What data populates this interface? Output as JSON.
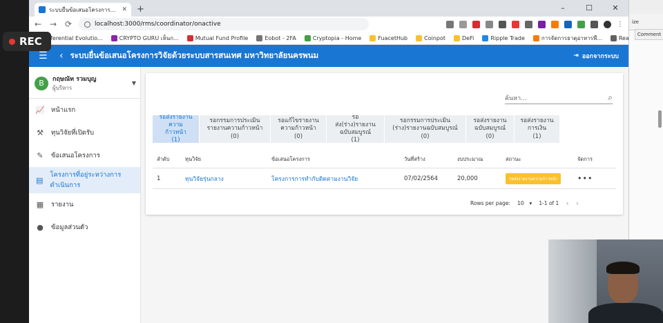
{
  "overlay": {
    "rec_label": "REC"
  },
  "browser": {
    "tab_title": "ระบบยื่นข้อเสนอโครงการวิจัยด้วยระบบสารสนเทศ",
    "url": "localhost:3000/rms/coordinator/onactive",
    "bookmarks": [
      {
        "label": "Differential Evolutio...",
        "color": "#3949ab"
      },
      {
        "label": "CRYPTO GURU เห็นก...",
        "color": "#8e24aa"
      },
      {
        "label": "Mutual Fund Profile",
        "color": "#d32f2f"
      },
      {
        "label": "Eobot - 2FA",
        "color": "#757575"
      },
      {
        "label": "Cryptopia - Home",
        "color": "#43a047"
      },
      {
        "label": "FuacetHub",
        "color": "#fbc02d"
      },
      {
        "label": "Coinpot",
        "color": "#fbc02d"
      },
      {
        "label": "DeFi",
        "color": "#fbc02d"
      },
      {
        "label": "Ripple Trade",
        "color": "#1e88e5"
      },
      {
        "label": "การจัดการธาตุอาหารพื...",
        "color": "#f57c00"
      },
      {
        "label": "Reading list",
        "color": "#616161"
      }
    ]
  },
  "app": {
    "title": "ระบบยื่นข้อเสนอโครงการวิจัยด้วยระบบสารสนเทศ มหาวิทยาลัยนครพนม",
    "logout_label": "ออกจากระบบ",
    "user": {
      "initial": "B",
      "name": "กฤษณัท รวมบุญ",
      "role": "ผู้บริหาร"
    },
    "menu": [
      {
        "label": "หน้าแรก",
        "icon": "chart-icon"
      },
      {
        "label": "ทุนวิจัยที่เปิดรับ",
        "icon": "hammer-icon"
      },
      {
        "label": "ข้อเสนอโครงการ",
        "icon": "edit-icon"
      },
      {
        "label": "โครงการที่อยู่ระหว่างการดำเนินการ",
        "icon": "document-icon"
      },
      {
        "label": "รายงาน",
        "icon": "report-icon"
      },
      {
        "label": "ข้อมูลส่วนตัว",
        "icon": "person-icon"
      }
    ],
    "search_placeholder": "ค้นหา...",
    "status_tabs": [
      {
        "line1": "รอส่งรายงาน",
        "line2": "ความก้าวหน้า",
        "count": "(1)"
      },
      {
        "line1": "รอกรรมการประเมิน",
        "line2": "รายงานความก้าวหน้า",
        "count": "(0)"
      },
      {
        "line1": "รอแก้ไขรายงาน",
        "line2": "ความก้าวหน้า",
        "count": "(0)"
      },
      {
        "line1": "รอส่ง(ร่าง)รายงาน",
        "line2": "ฉบับสมบูรณ์",
        "count": "(1)"
      },
      {
        "line1": "รอกรรมการประเมิน",
        "line2": "(ร่าง)รายงานฉบับสมบูรณ์",
        "count": "(0)"
      },
      {
        "line1": "รอส่งรายงาน",
        "line2": "ฉบับสมบูรณ์",
        "count": "(0)"
      },
      {
        "line1": "รอส่งรายงาน",
        "line2": "การเงิน",
        "count": "(1)"
      }
    ],
    "table": {
      "headers": [
        "ลำดับ",
        "ทุนวิจัย",
        "ข้อเสนอโครงการ",
        "วันที่สร้าง",
        "งบประมาณ",
        "สถานะ",
        "จัดการ"
      ],
      "rows": [
        {
          "no": "1",
          "grant": "ทุนวิจัยรุ่นกลาง",
          "proposal": "โครงการการทำกับติดตามงานวิจัย",
          "created": "07/02/2564",
          "budget": "20,000",
          "status": "รอส่งรายงานความก้าวหน้า",
          "actions": "•••"
        }
      ]
    },
    "pager": {
      "rows_label": "Rows per page:",
      "rows_value": "10",
      "range": "1-1 of 1"
    }
  },
  "sidewin": {
    "zoom_label": "ize",
    "comment_label": "Comment"
  }
}
